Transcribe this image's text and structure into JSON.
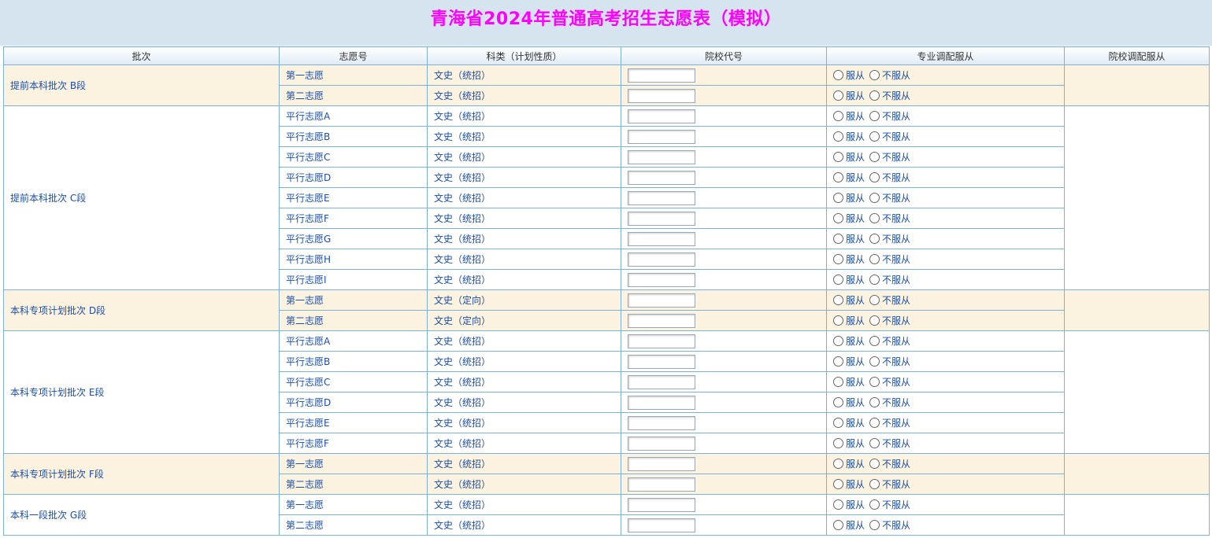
{
  "page": {
    "title": "青海省2024年普通高考招生志愿表（模拟）"
  },
  "table": {
    "headers": [
      "批次",
      "志愿号",
      "科类（计划性质）",
      "院校代号",
      "专业调配服从",
      "院校调配服从"
    ],
    "obey_label": "服从",
    "not_obey_label": "不服从",
    "rows": [
      {
        "batch": "提前本科批次 B段",
        "span": 2,
        "alt": true,
        "choice": "第一志愿",
        "category": "文史（统招）"
      },
      {
        "batch": "",
        "alt": true,
        "choice": "第二志愿",
        "category": "文史（统招）"
      },
      {
        "batch": "提前本科批次 C段",
        "span": 9,
        "alt": false,
        "choice": "平行志愿A",
        "category": "文史（统招）"
      },
      {
        "batch": "",
        "alt": false,
        "choice": "平行志愿B",
        "category": "文史（统招）"
      },
      {
        "batch": "",
        "alt": false,
        "choice": "平行志愿C",
        "category": "文史（统招）"
      },
      {
        "batch": "",
        "alt": false,
        "choice": "平行志愿D",
        "category": "文史（统招）"
      },
      {
        "batch": "",
        "alt": false,
        "choice": "平行志愿E",
        "category": "文史（统招）"
      },
      {
        "batch": "",
        "alt": false,
        "choice": "平行志愿F",
        "category": "文史（统招）"
      },
      {
        "batch": "",
        "alt": false,
        "choice": "平行志愿G",
        "category": "文史（统招）"
      },
      {
        "batch": "",
        "alt": false,
        "choice": "平行志愿H",
        "category": "文史（统招）"
      },
      {
        "batch": "",
        "alt": false,
        "choice": "平行志愿I",
        "category": "文史（统招）"
      },
      {
        "batch": "本科专项计划批次 D段",
        "span": 2,
        "alt": true,
        "choice": "第一志愿",
        "category": "文史（定向）"
      },
      {
        "batch": "",
        "alt": true,
        "choice": "第二志愿",
        "category": "文史（定向）"
      },
      {
        "batch": "本科专项计划批次 E段",
        "span": 6,
        "alt": false,
        "choice": "平行志愿A",
        "category": "文史（统招）"
      },
      {
        "batch": "",
        "alt": false,
        "choice": "平行志愿B",
        "category": "文史（统招）"
      },
      {
        "batch": "",
        "alt": false,
        "choice": "平行志愿C",
        "category": "文史（统招）"
      },
      {
        "batch": "",
        "alt": false,
        "choice": "平行志愿D",
        "category": "文史（统招）"
      },
      {
        "batch": "",
        "alt": false,
        "choice": "平行志愿E",
        "category": "文史（统招）"
      },
      {
        "batch": "",
        "alt": false,
        "choice": "平行志愿F",
        "category": "文史（统招）"
      },
      {
        "batch": "本科专项计划批次 F段",
        "span": 2,
        "alt": true,
        "choice": "第一志愿",
        "category": "文史（统招）"
      },
      {
        "batch": "",
        "alt": true,
        "choice": "第二志愿",
        "category": "文史（统招）"
      },
      {
        "batch": "本科一段批次 G段",
        "span": 2,
        "alt": false,
        "choice": "第一志愿",
        "category": "文史（统招）"
      },
      {
        "batch": "",
        "alt": false,
        "choice": "第二志愿",
        "category": "文史（统招）"
      }
    ]
  }
}
